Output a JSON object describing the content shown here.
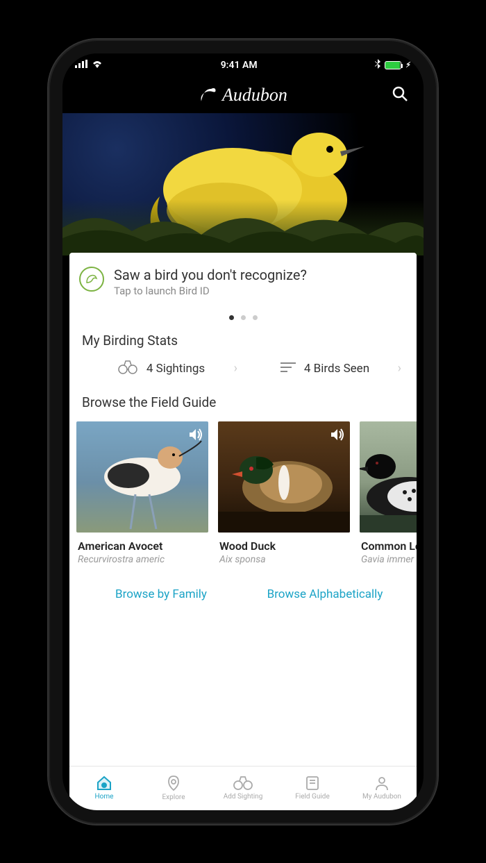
{
  "status": {
    "time": "9:41 AM"
  },
  "header": {
    "logo_text": "Audubon"
  },
  "bird_id": {
    "title": "Saw a bird you don't recognize?",
    "subtitle": "Tap to launch Bird ID"
  },
  "stats": {
    "heading": "My Birding Stats",
    "sightings": "4 Sightings",
    "seen": "4 Birds Seen"
  },
  "field_guide": {
    "heading": "Browse the Field Guide",
    "cards": [
      {
        "name": "American Avocet",
        "latin": "Recurvirostra americ"
      },
      {
        "name": "Wood Duck",
        "latin": "Aix sponsa"
      },
      {
        "name": "Common Loon",
        "latin": "Gavia immer"
      }
    ],
    "browse_family": "Browse by Family",
    "browse_alpha": "Browse Alphabetically"
  },
  "tabs": {
    "home": "Home",
    "explore": "Explore",
    "add": "Add Sighting",
    "guide": "Field Guide",
    "my": "My Audubon"
  }
}
